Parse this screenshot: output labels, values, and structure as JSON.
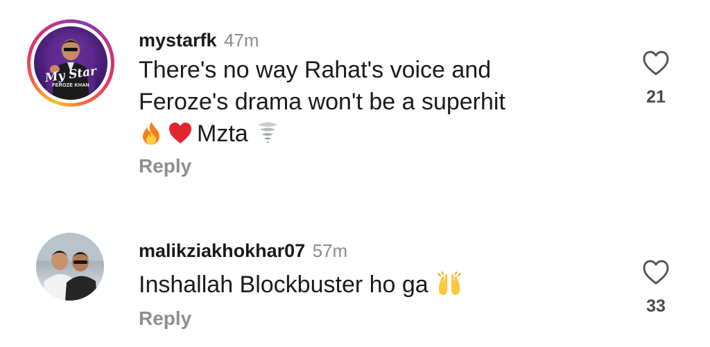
{
  "comments": [
    {
      "username": "mystarfk",
      "time": "47m",
      "text_lines": [
        "There's no way Rahat's voice and",
        "Feroze's drama won't be a superhit"
      ],
      "emoji_line_text": "Mzta",
      "emoji_icons": [
        "fire-emoji",
        "red-heart-emoji",
        "tornado-emoji"
      ],
      "reply_label": "Reply",
      "like_count": "21",
      "avatar": {
        "story_ring": true,
        "logo_text": "My Star",
        "logo_subtext": "FEROZE KHAN"
      }
    },
    {
      "username": "malikziakhokhar07",
      "time": "57m",
      "text": "Inshallah Blockbuster ho ga",
      "emoji_icons": [
        "raising-hands-emoji"
      ],
      "reply_label": "Reply",
      "like_count": "33",
      "avatar": {
        "story_ring": false
      }
    }
  ],
  "colors": {
    "text": "#1a1a1a",
    "muted": "#8e8e8e",
    "ring_start": "#f9c12e",
    "ring_end": "#833ab4"
  }
}
